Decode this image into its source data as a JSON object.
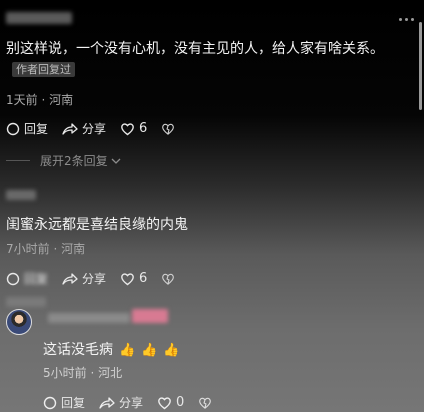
{
  "comments": [
    {
      "text": "别这样说，一个没有心机，没有主见的人，给人家有啥关系。",
      "author_tag": "作者回复过",
      "meta": "1天前 · 河南",
      "reply_label": "回复",
      "share_label": "分享",
      "likes": "6"
    },
    {
      "expand_label": "展开2条回复"
    },
    {
      "text": "闺蜜永远都是喜结良缘的内鬼",
      "meta": "7小时前 · 河南",
      "reply_label": "回复",
      "share_label": "分享",
      "likes": "6"
    },
    {
      "text": "这话没毛病",
      "emojis": [
        "👍",
        "👍",
        "👍"
      ],
      "meta": "5小时前 · 河北",
      "reply_label": "回复",
      "share_label": "分享",
      "likes": "0"
    }
  ]
}
